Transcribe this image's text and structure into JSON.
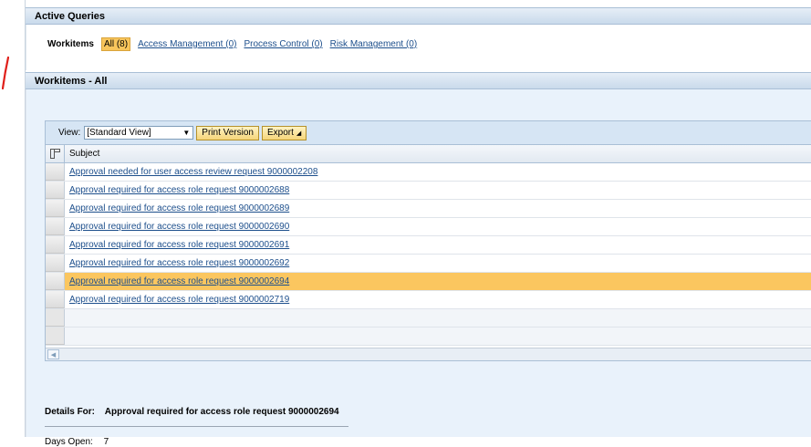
{
  "active_queries": {
    "title": "Active Queries",
    "label": "Workitems",
    "all": "All (8)",
    "links": [
      "Access Management (0)",
      "Process Control (0)",
      "Risk Management (0)"
    ]
  },
  "workitems": {
    "title": "Workitems - All",
    "toolbar": {
      "view_label": "View:",
      "view_value": "[Standard View]",
      "print_label": "Print Version",
      "export_label": "Export"
    },
    "column_subject": "Subject",
    "rows": [
      "Approval needed for user access review request 9000002208",
      "Approval required for access role request 9000002688",
      "Approval required for access role request 9000002689",
      "Approval required for access role request 9000002690",
      "Approval required for access role request 9000002691",
      "Approval required for access role request 9000002692",
      "Approval required for access role request 9000002694",
      "Approval required for access role request 9000002719"
    ],
    "selected_index": 6
  },
  "details": {
    "label": "Details For:",
    "subject": "Approval required for access role request 9000002694",
    "days_open_label": "Days Open:",
    "days_open_value": "7"
  },
  "colors": {
    "highlight": "#fbc65f",
    "link": "#1d4f8c",
    "header_bg": "#c9daeb",
    "pen_mark": "#e0201b"
  }
}
